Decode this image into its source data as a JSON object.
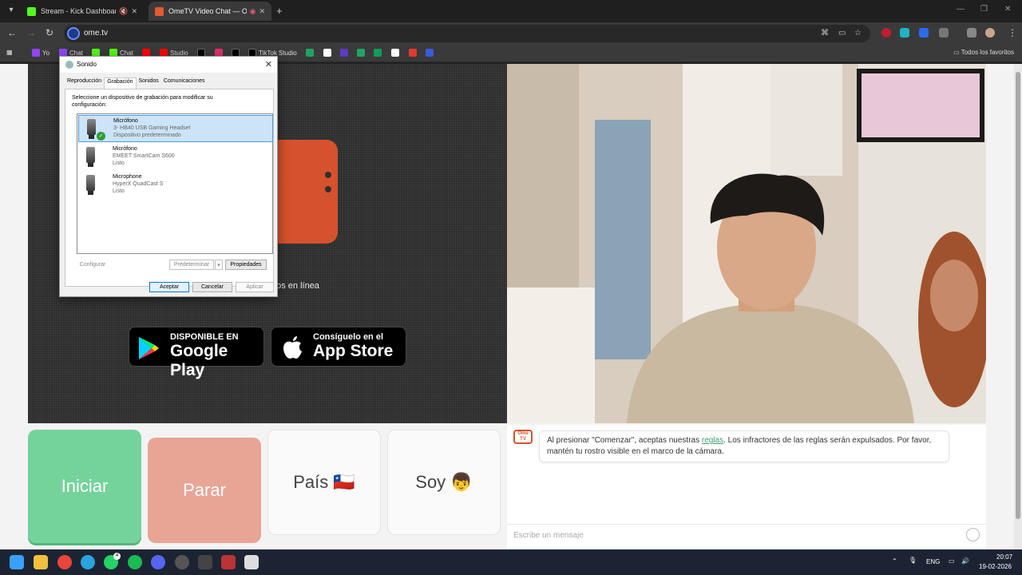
{
  "browser": {
    "tabs": [
      {
        "title": "Stream - Kick Dashboard",
        "color": "#53fc18"
      },
      {
        "title": "OmeTV Video Chat — Ome",
        "color": "#e35b2e"
      }
    ],
    "new_tab": "+",
    "url": "ome.tv",
    "bookmarks": [
      {
        "label": "Yo",
        "color": "#9146ff"
      },
      {
        "label": "Chat",
        "color": "#9146ff"
      },
      {
        "label": "Chat",
        "color": "#53fc18"
      },
      {
        "label": "Studio",
        "color": "#ff0000"
      },
      {
        "label": "TikTok Studio",
        "color": "#ffffff"
      }
    ],
    "all_bookmarks": "Todos los favoritos"
  },
  "page": {
    "tagline": "rios en línea",
    "google_play": {
      "small": "DISPONIBLE EN",
      "big": "Google Play"
    },
    "app_store": {
      "small": "Consíguelo en el",
      "big": "App Store"
    },
    "buttons": {
      "start": "Iniciar",
      "stop": "Parar",
      "country": "País",
      "country_flag": "🇨🇱",
      "me": "Soy",
      "me_emoji": "👦"
    },
    "chat": {
      "icon_text": "Ome TV",
      "msg_before": "Al presionar \"Comenzar\", aceptas nuestras ",
      "msg_link": "reglas",
      "msg_after": ". Los infractores de las reglas serán expulsados. Por favor, mantén tu rostro visible en el marco de la cámara.",
      "placeholder": "Escribe un mensaje"
    }
  },
  "dialog": {
    "title": "Sonido",
    "close": "✕",
    "tabs": [
      "Reproducción",
      "Grabación",
      "Sonidos",
      "Comunicaciones"
    ],
    "active_tab": "Grabación",
    "instruction": "Seleccione un dispositivo de grabación para modificar su configuración:",
    "devices": [
      {
        "name": "Micrófono",
        "model": "3- HB40 USB Gaming Headset",
        "status": "Dispositivo predeterminado",
        "selected": true
      },
      {
        "name": "Micrófono",
        "model": "EMEET SmartCam S600",
        "status": "Listo",
        "selected": false
      },
      {
        "name": "Microphone",
        "model": "HyperX QuadCast S",
        "status": "Listo",
        "selected": false
      }
    ],
    "configure": "Configurar",
    "set_default": "Predeterminar",
    "properties": "Propiedades",
    "ok": "Aceptar",
    "cancel": "Cancelar",
    "apply": "Aplicar"
  },
  "taskbar": {
    "lang": "ENG",
    "time": "20:07",
    "date": "19-02-2026",
    "whatsapp_badge": "4"
  }
}
